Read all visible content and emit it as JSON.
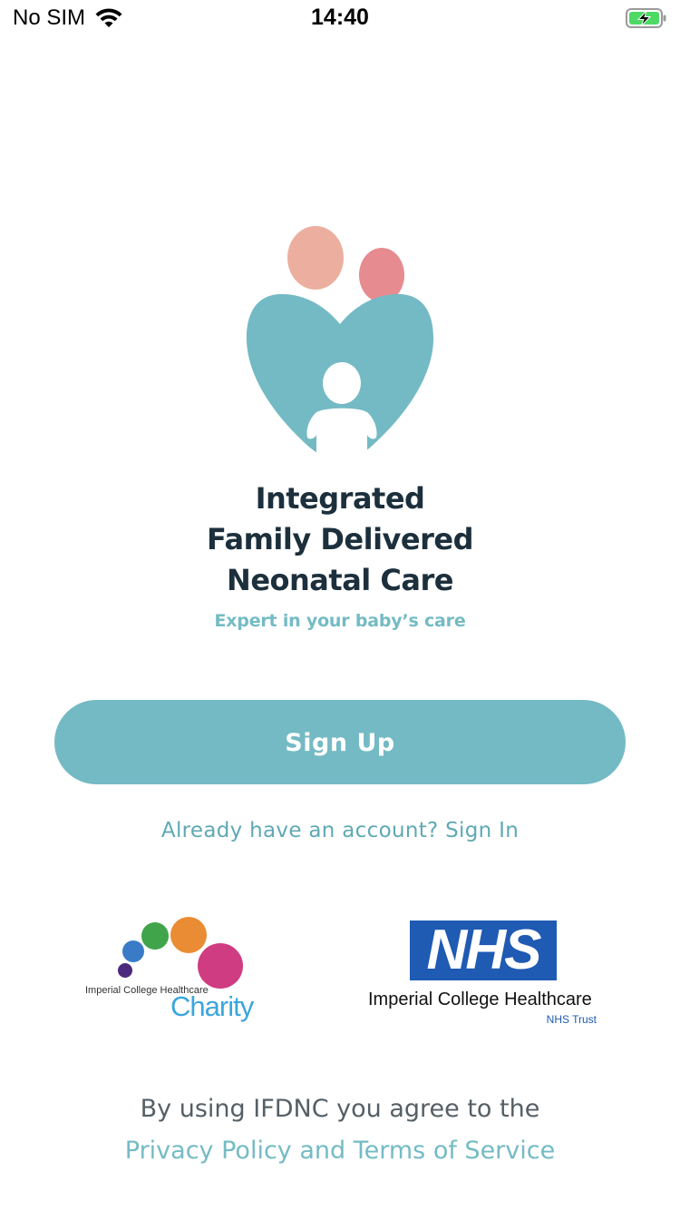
{
  "status_bar": {
    "carrier": "No SIM",
    "time": "14:40",
    "wifi_icon": "wifi-icon",
    "battery_icon": "battery-charging-icon"
  },
  "app": {
    "logo_icon": "family-heart-logo-icon",
    "title_lines": [
      "Integrated",
      "Family Delivered",
      "Neonatal Care"
    ],
    "tagline": "Expert in your baby’s care"
  },
  "actions": {
    "signup_label": "Sign Up",
    "signin_text": "Already have an account? Sign In"
  },
  "partners": {
    "charity_org": "Imperial College Healthcare",
    "charity_name": "Charity",
    "nhs_letters": "NHS",
    "nhs_org": "Imperial College Healthcare",
    "nhs_trust": "NHS Trust"
  },
  "footer": {
    "terms_prefix": "By using IFDNC you agree to the",
    "terms_link": "Privacy Policy and Terms of Service"
  },
  "colors": {
    "accent": "#74bac4",
    "title": "#1c2f3c",
    "battery": "#4cd964",
    "nhs_blue": "#1f5ab3"
  }
}
